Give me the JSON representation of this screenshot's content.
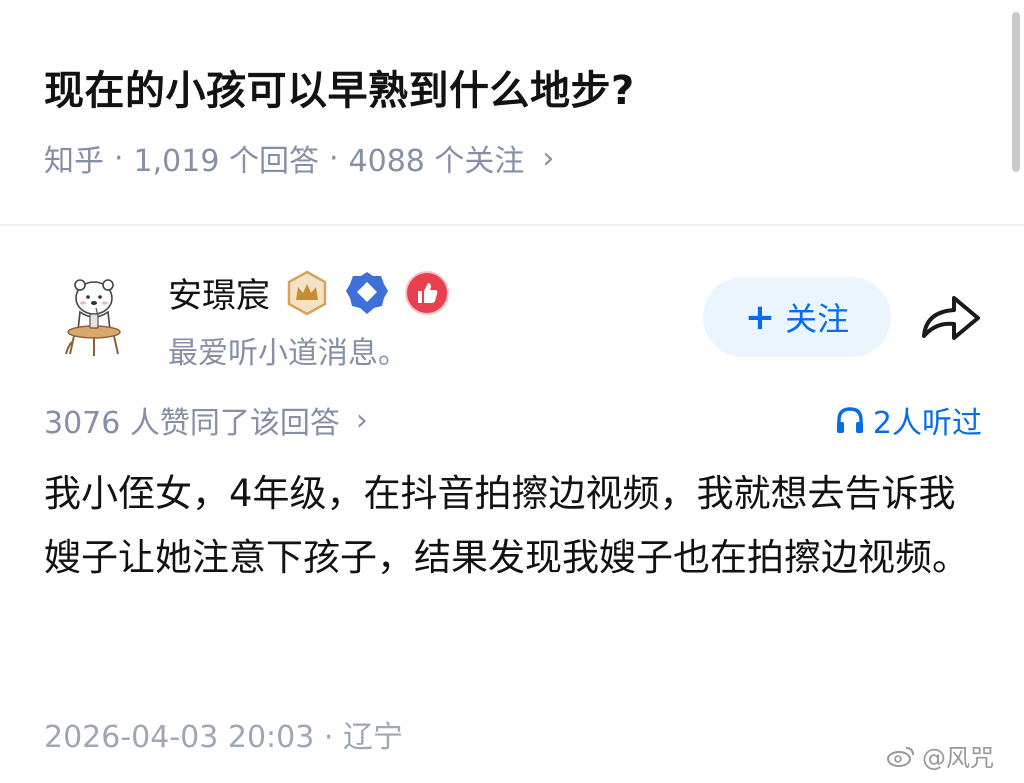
{
  "question": {
    "title": "现在的小孩可以早熟到什么地步?",
    "source": "知乎",
    "separator": "·",
    "answers": "1,019 个回答",
    "follows": "4088 个关注",
    "chevron": "›"
  },
  "author": {
    "name": "安璟宸",
    "bio": "最爱听小道消息。",
    "badges": [
      "crown-badge",
      "diamond-badge",
      "thumbs-up-badge"
    ],
    "follow_label": "+ 关注",
    "follow_plus": "+",
    "follow_text": "关注"
  },
  "answer": {
    "votes": "3076 人赞同了该回答",
    "listen": "2人听过",
    "body": "我小侄女，4年级，在抖音拍擦边视频，我就想去告诉我嫂子让她注意下孩子，结果发现我嫂子也在拍擦边视频。",
    "time": "2026-04-03 20:03 · 辽宁"
  },
  "watermark": "@风咒",
  "colors": {
    "accent": "#056de8",
    "follow_bg": "#ebf5ff",
    "meta_gray": "#8590a6"
  }
}
